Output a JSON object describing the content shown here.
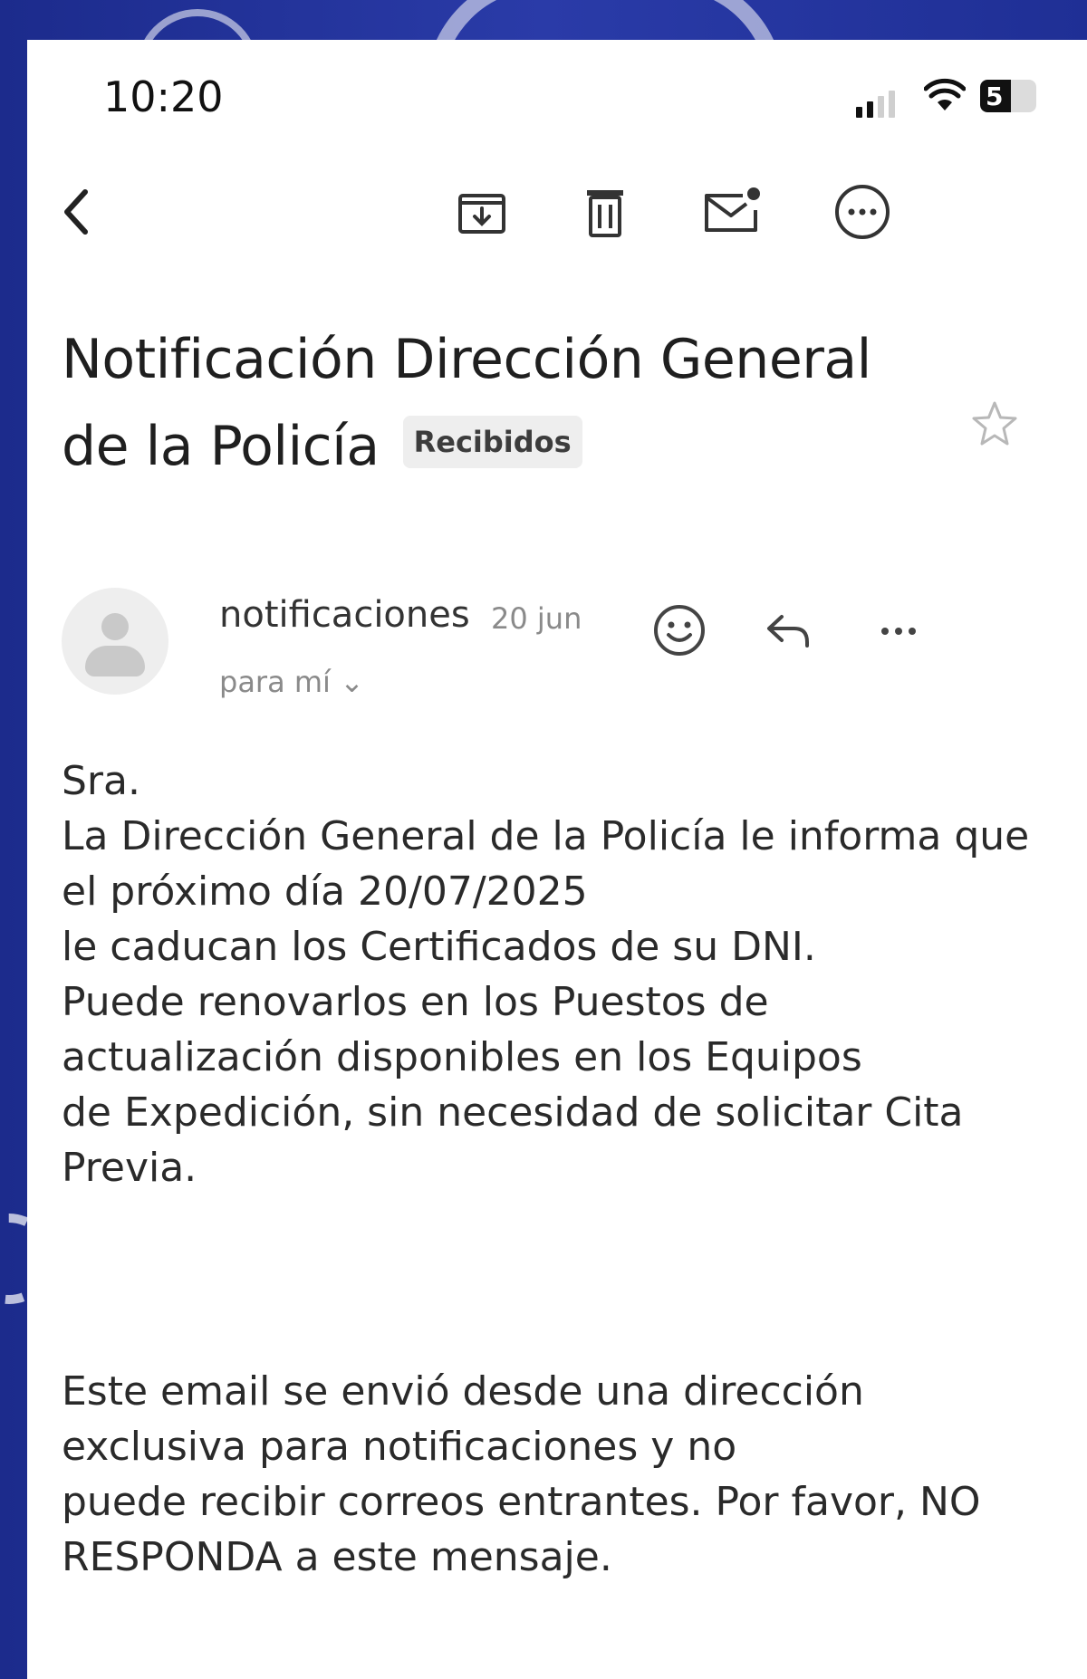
{
  "status_bar": {
    "time": "10:20",
    "battery_level": "5"
  },
  "toolbar": {
    "icons": [
      "back-arrow-icon",
      "archive-icon",
      "trash-icon",
      "mark-unread-icon",
      "more-options-icon"
    ]
  },
  "email": {
    "subject_line1": "Notificación Dirección General",
    "subject_line2": "de la Policía",
    "label": "Recibidos",
    "sender": "notificaciones",
    "date": "20 jun",
    "recipient": "para mí ⌄",
    "body_lines": [
      "Sra.",
      "La Dirección General de la Policía le informa que",
      "el próximo día 20/07/2025",
      "le caducan los Certificados de su DNI.",
      "Puede renovarlos en los Puestos de",
      "actualización disponibles en los Equipos",
      "de Expedición, sin necesidad de solicitar Cita",
      "Previa."
    ],
    "footer_lines": [
      "Este email se envió desde una dirección",
      "exclusiva para notificaciones y no",
      "puede recibir correos entrantes. Por favor, NO",
      "RESPONDA a este mensaje."
    ]
  },
  "colors": {
    "background_blue": "#23349c",
    "text": "#1f1f1f",
    "muted": "#8a8a8a"
  }
}
